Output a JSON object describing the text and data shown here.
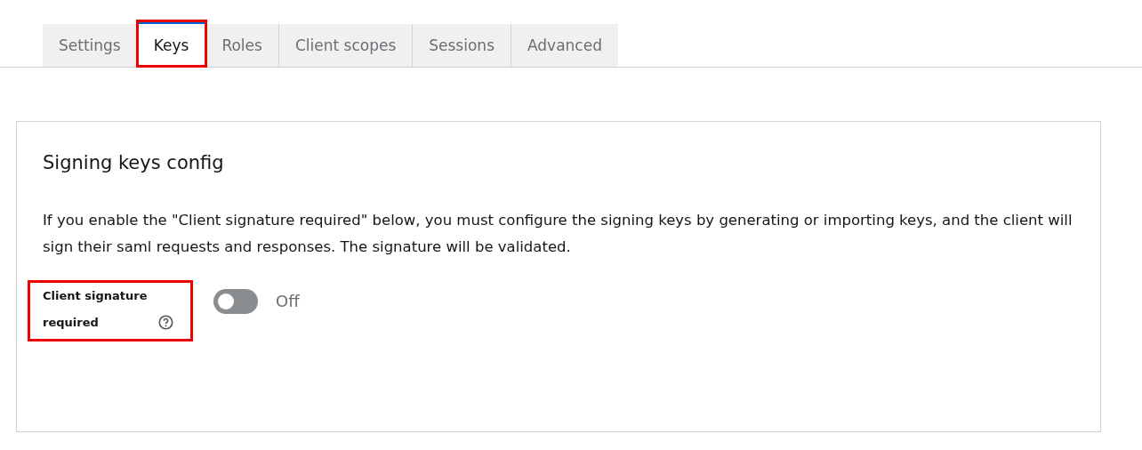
{
  "tabs": [
    {
      "label": "Settings",
      "selected": false,
      "highlighted": false
    },
    {
      "label": "Keys",
      "selected": true,
      "highlighted": true
    },
    {
      "label": "Roles",
      "selected": false,
      "highlighted": false
    },
    {
      "label": "Client scopes",
      "selected": false,
      "highlighted": false
    },
    {
      "label": "Sessions",
      "selected": false,
      "highlighted": false
    },
    {
      "label": "Advanced",
      "selected": false,
      "highlighted": false
    }
  ],
  "card": {
    "title": "Signing keys config",
    "description": "If you enable the \"Client signature required\" below, you must configure the signing keys by generating or importing keys, and the client will sign their saml requests and responses. The signature will be validated.",
    "field": {
      "label": "Client signature required",
      "highlighted": true,
      "on": false,
      "state_text": "Off"
    }
  }
}
